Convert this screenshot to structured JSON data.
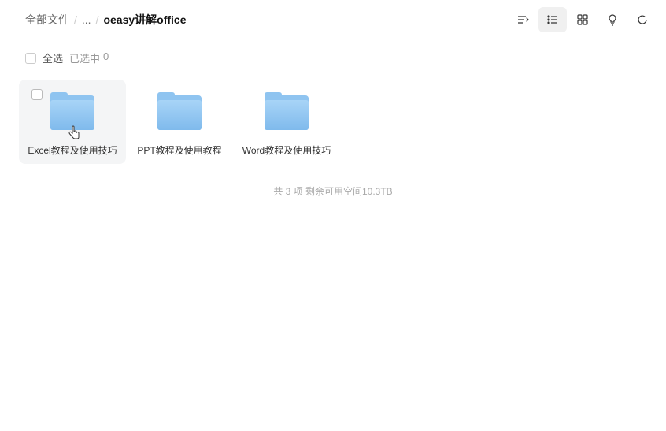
{
  "breadcrumb": {
    "root": "全部文件",
    "ellipsis": "...",
    "current": "oeasy讲解office"
  },
  "selectBar": {
    "selectAll": "全选",
    "selectedLabel": "已选中",
    "selectedCount": "0"
  },
  "folders": [
    {
      "name": "Excel教程及使用技巧"
    },
    {
      "name": "PPT教程及使用教程"
    },
    {
      "name": "Word教程及使用技巧"
    }
  ],
  "footer": {
    "text": "共 3 项 剩余可用空间10.3TB"
  }
}
